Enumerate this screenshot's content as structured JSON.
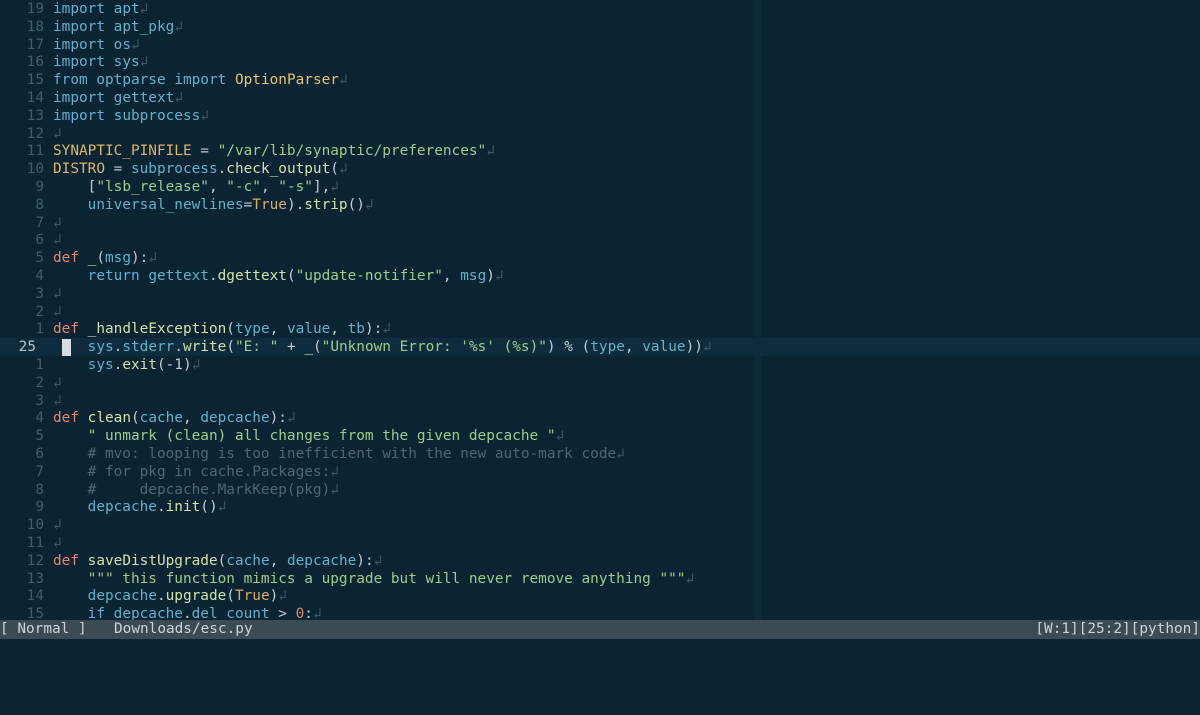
{
  "editor": {
    "current_line_number": "25",
    "eol_glyph": "↲",
    "lines": [
      {
        "n": "19",
        "tokens": [
          [
            "kw",
            "import"
          ],
          [
            "pl",
            " "
          ],
          [
            "id",
            "apt"
          ]
        ]
      },
      {
        "n": "18",
        "tokens": [
          [
            "kw",
            "import"
          ],
          [
            "pl",
            " "
          ],
          [
            "id",
            "apt_pkg"
          ]
        ]
      },
      {
        "n": "17",
        "tokens": [
          [
            "kw",
            "import"
          ],
          [
            "pl",
            " "
          ],
          [
            "id",
            "os"
          ]
        ]
      },
      {
        "n": "16",
        "tokens": [
          [
            "kw",
            "import"
          ],
          [
            "pl",
            " "
          ],
          [
            "id",
            "sys"
          ]
        ]
      },
      {
        "n": "15",
        "tokens": [
          [
            "kw",
            "from"
          ],
          [
            "pl",
            " "
          ],
          [
            "id",
            "optparse"
          ],
          [
            "pl",
            " "
          ],
          [
            "kw",
            "import"
          ],
          [
            "pl",
            " "
          ],
          [
            "cls",
            "OptionParser"
          ]
        ]
      },
      {
        "n": "14",
        "tokens": [
          [
            "kw",
            "import"
          ],
          [
            "pl",
            " "
          ],
          [
            "id",
            "gettext"
          ]
        ]
      },
      {
        "n": "13",
        "tokens": [
          [
            "kw",
            "import"
          ],
          [
            "pl",
            " "
          ],
          [
            "id",
            "subprocess"
          ]
        ]
      },
      {
        "n": "12",
        "tokens": []
      },
      {
        "n": "11",
        "tokens": [
          [
            "var",
            "SYNAPTIC_PINFILE"
          ],
          [
            "op",
            " = "
          ],
          [
            "str",
            "\"/var/lib/synaptic/preferences\""
          ]
        ]
      },
      {
        "n": "10",
        "tokens": [
          [
            "var",
            "DISTRO"
          ],
          [
            "op",
            " = "
          ],
          [
            "id",
            "subprocess"
          ],
          [
            "pl",
            "."
          ],
          [
            "fn",
            "check_output"
          ],
          [
            "pl",
            "("
          ]
        ]
      },
      {
        "n": "9",
        "tokens": [
          [
            "pl",
            "    ["
          ],
          [
            "str",
            "\"lsb_release\""
          ],
          [
            "pl",
            ", "
          ],
          [
            "str",
            "\"-c\""
          ],
          [
            "pl",
            ", "
          ],
          [
            "str",
            "\"-s\""
          ],
          [
            "pl",
            "],"
          ]
        ]
      },
      {
        "n": "8",
        "tokens": [
          [
            "pl",
            "    "
          ],
          [
            "id",
            "universal_newlines"
          ],
          [
            "op",
            "="
          ],
          [
            "const",
            "True"
          ],
          [
            "pl",
            ")."
          ],
          [
            "fn",
            "strip"
          ],
          [
            "pl",
            "()"
          ]
        ]
      },
      {
        "n": "7",
        "tokens": []
      },
      {
        "n": "6",
        "tokens": []
      },
      {
        "n": "5",
        "tokens": [
          [
            "def",
            "def"
          ],
          [
            "pl",
            " "
          ],
          [
            "fn",
            "_"
          ],
          [
            "pl",
            "("
          ],
          [
            "id",
            "msg"
          ],
          [
            "pl",
            "):"
          ]
        ]
      },
      {
        "n": "4",
        "tokens": [
          [
            "pl",
            "    "
          ],
          [
            "kw",
            "return"
          ],
          [
            "pl",
            " "
          ],
          [
            "id",
            "gettext"
          ],
          [
            "pl",
            "."
          ],
          [
            "fn",
            "dgettext"
          ],
          [
            "pl",
            "("
          ],
          [
            "str",
            "\"update-notifier\""
          ],
          [
            "pl",
            ", "
          ],
          [
            "id",
            "msg"
          ],
          [
            "pl",
            ")"
          ]
        ]
      },
      {
        "n": "3",
        "tokens": []
      },
      {
        "n": "2",
        "tokens": []
      },
      {
        "n": "1",
        "tokens": [
          [
            "def",
            "def"
          ],
          [
            "pl",
            " "
          ],
          [
            "fn",
            "_handleException"
          ],
          [
            "pl",
            "("
          ],
          [
            "id",
            "type"
          ],
          [
            "pl",
            ", "
          ],
          [
            "id",
            "value"
          ],
          [
            "pl",
            ", "
          ],
          [
            "id",
            "tb"
          ],
          [
            "pl",
            "):"
          ]
        ]
      },
      {
        "n": "25",
        "current": true,
        "tokens": [
          [
            "pl",
            "    "
          ],
          [
            "id",
            "sys"
          ],
          [
            "pl",
            "."
          ],
          [
            "id",
            "stderr"
          ],
          [
            "pl",
            "."
          ],
          [
            "fn",
            "write"
          ],
          [
            "pl",
            "("
          ],
          [
            "str",
            "\"E: \""
          ],
          [
            "op",
            " + "
          ],
          [
            "fn",
            "_"
          ],
          [
            "pl",
            "("
          ],
          [
            "str",
            "\"Unknown Error: '%s' (%s)\""
          ],
          [
            "pl",
            ") "
          ],
          [
            "op",
            "%"
          ],
          [
            "pl",
            " ("
          ],
          [
            "id",
            "type"
          ],
          [
            "pl",
            ", "
          ],
          [
            "id",
            "value"
          ],
          [
            "pl",
            "))"
          ]
        ]
      },
      {
        "n": "1",
        "tokens": [
          [
            "pl",
            "    "
          ],
          [
            "id",
            "sys"
          ],
          [
            "pl",
            "."
          ],
          [
            "fn",
            "exit"
          ],
          [
            "pl",
            "(-1)"
          ]
        ]
      },
      {
        "n": "2",
        "tokens": []
      },
      {
        "n": "3",
        "tokens": []
      },
      {
        "n": "4",
        "tokens": [
          [
            "def",
            "def"
          ],
          [
            "pl",
            " "
          ],
          [
            "fn",
            "clean"
          ],
          [
            "pl",
            "("
          ],
          [
            "id",
            "cache"
          ],
          [
            "pl",
            ", "
          ],
          [
            "id",
            "depcache"
          ],
          [
            "pl",
            "):"
          ]
        ]
      },
      {
        "n": "5",
        "tokens": [
          [
            "pl",
            "    "
          ],
          [
            "str",
            "\" unmark (clean) all changes from the given depcache \""
          ]
        ]
      },
      {
        "n": "6",
        "tokens": [
          [
            "pl",
            "    "
          ],
          [
            "cm",
            "# mvo: looping is too inefficient with the new auto-mark code"
          ]
        ]
      },
      {
        "n": "7",
        "tokens": [
          [
            "pl",
            "    "
          ],
          [
            "cm",
            "# for pkg in cache.Packages:"
          ]
        ]
      },
      {
        "n": "8",
        "tokens": [
          [
            "pl",
            "    "
          ],
          [
            "cm",
            "#     depcache.MarkKeep(pkg)"
          ]
        ]
      },
      {
        "n": "9",
        "tokens": [
          [
            "pl",
            "    "
          ],
          [
            "id",
            "depcache"
          ],
          [
            "pl",
            "."
          ],
          [
            "fn",
            "init"
          ],
          [
            "pl",
            "()"
          ]
        ]
      },
      {
        "n": "10",
        "tokens": []
      },
      {
        "n": "11",
        "tokens": []
      },
      {
        "n": "12",
        "tokens": [
          [
            "def",
            "def"
          ],
          [
            "pl",
            " "
          ],
          [
            "fn",
            "saveDistUpgrade"
          ],
          [
            "pl",
            "("
          ],
          [
            "id",
            "cache"
          ],
          [
            "pl",
            ", "
          ],
          [
            "id",
            "depcache"
          ],
          [
            "pl",
            "):"
          ]
        ]
      },
      {
        "n": "13",
        "tokens": [
          [
            "pl",
            "    "
          ],
          [
            "str",
            "\"\"\" this function mimics a upgrade but will never remove anything \"\"\""
          ]
        ]
      },
      {
        "n": "14",
        "tokens": [
          [
            "pl",
            "    "
          ],
          [
            "id",
            "depcache"
          ],
          [
            "pl",
            "."
          ],
          [
            "fn",
            "upgrade"
          ],
          [
            "pl",
            "("
          ],
          [
            "const",
            "True"
          ],
          [
            "pl",
            ")"
          ]
        ]
      },
      {
        "n": "15",
        "tokens": [
          [
            "pl",
            "    "
          ],
          [
            "kw",
            "if"
          ],
          [
            "pl",
            " "
          ],
          [
            "id",
            "depcache"
          ],
          [
            "pl",
            "."
          ],
          [
            "id",
            "del_count"
          ],
          [
            "op",
            " > "
          ],
          [
            "num",
            "0"
          ],
          [
            "pl",
            ":"
          ]
        ]
      }
    ]
  },
  "statusbar": {
    "mode": "[ Normal ]",
    "file_icon": "python-icon",
    "filename": "Downloads/esc.py",
    "right": "[W:1][25:2][python]"
  },
  "colors": {
    "background": "#0a2434",
    "statusbar": "#3b4a53",
    "keyword": "#62b0cf",
    "def": "#e5876b",
    "string": "#9fcb8a",
    "comment": "#4c6777",
    "function": "#cfe3a6"
  }
}
